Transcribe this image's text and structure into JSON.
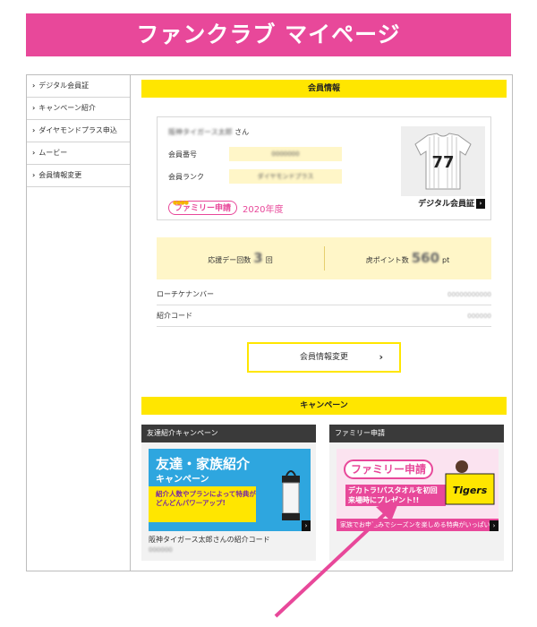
{
  "page_banner": {
    "title": "ファンクラブ マイページ",
    "color": "#e8489a"
  },
  "sidebar": {
    "items": [
      {
        "label": "デジタル会員証"
      },
      {
        "label": "キャンペーン紹介"
      },
      {
        "label": "ダイヤモンドプラス申込"
      },
      {
        "label": "ムービー"
      },
      {
        "label": "会員情報変更"
      }
    ]
  },
  "member_info": {
    "section_title": "会員情報",
    "name_value": "阪神タイガース太郎",
    "name_suffix": "さん",
    "member_number_label": "会員番号",
    "member_number_value": "0000000",
    "member_rank_label": "会員ランク",
    "member_rank_value": "ダイヤモンドプラス",
    "family_badge": "ファミリー申請",
    "family_year": "2020年度",
    "jersey_number": "77",
    "digital_card_label": "デジタル会員証",
    "support_label": "応援デー回数",
    "support_count": "3",
    "support_unit": "回",
    "points_label": "虎ポイント数",
    "points_value": "560",
    "points_unit": "pt",
    "roach_label": "ローチケナンバー",
    "roach_value": "00000000000",
    "referral_label": "紹介コード",
    "referral_value": "000000",
    "edit_button": "会員情報変更",
    "accent_color": "#ffe600"
  },
  "campaign": {
    "section_title": "キャンペーン",
    "cards": [
      {
        "title": "友達紹介キャンペーン",
        "banner_title": "友達・家族紹介",
        "banner_sub": "キャンペーン",
        "banner_text": "紹介人数やプランによって特典がどんどんパワーアップ!",
        "caption": "阪神タイガース太郎さんの紹介コード",
        "code": "000000"
      },
      {
        "title": "ファミリー申請",
        "banner_badge": "ファミリー申請",
        "banner_text": "デカトラ!バスタオルを初回来場時にプレゼント!!",
        "banner_bottom": "家族でお申込みでシーズンを楽しめる特典がいっぱい!!",
        "towel_text": "Tigers"
      }
    ]
  }
}
